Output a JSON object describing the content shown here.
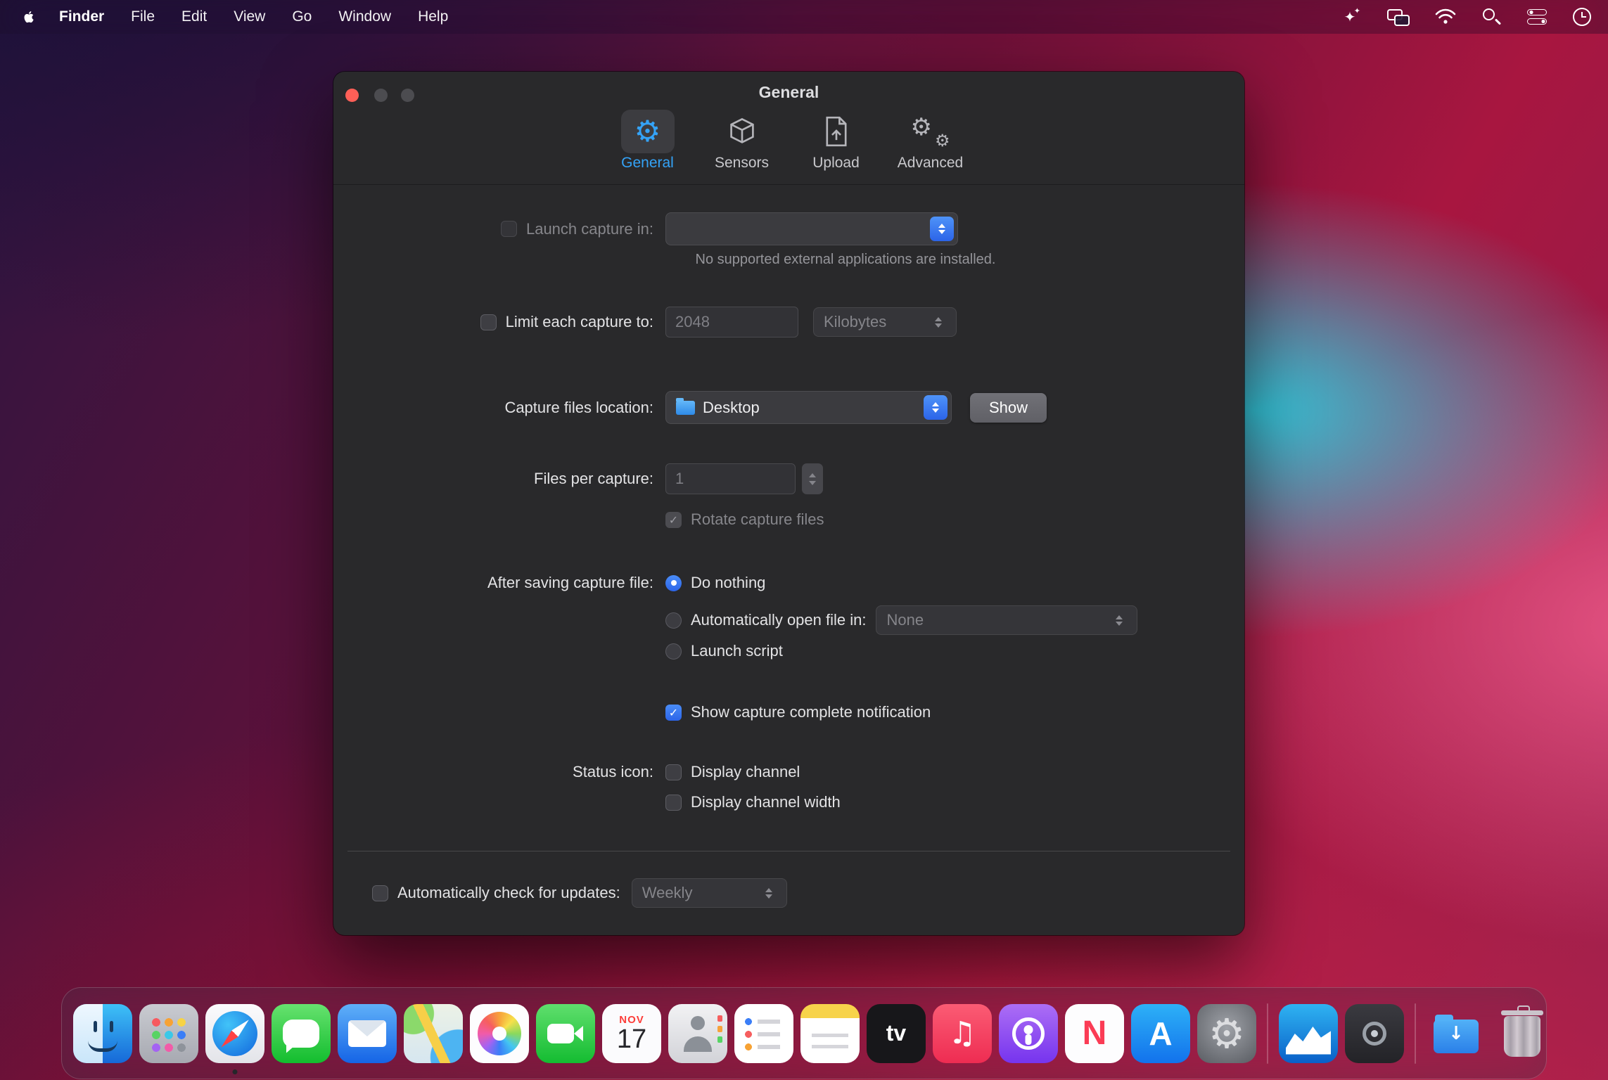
{
  "menu_bar": {
    "app_name": "Finder",
    "menus": [
      "File",
      "Edit",
      "View",
      "Go",
      "Window",
      "Help"
    ],
    "status_icons": [
      "menu-extra",
      "windows",
      "wifi",
      "search",
      "control-center",
      "clock"
    ]
  },
  "window": {
    "title": "General",
    "toolbar": {
      "tabs": [
        {
          "label": "General",
          "active": true
        },
        {
          "label": "Sensors",
          "active": false
        },
        {
          "label": "Upload",
          "active": false
        },
        {
          "label": "Advanced",
          "active": false
        }
      ]
    },
    "form": {
      "launch_capture": {
        "label": "Launch capture in:",
        "helper": "No supported external applications are installed.",
        "checked": false
      },
      "limit_capture": {
        "label": "Limit each capture to:",
        "value": "2048",
        "unit": "Kilobytes",
        "checked": false
      },
      "location": {
        "label": "Capture files location:",
        "value": "Desktop",
        "show_button": "Show"
      },
      "files_per_capture": {
        "label": "Files per capture:",
        "value": "1",
        "rotate": "Rotate capture files",
        "rotate_checked": true
      },
      "after_saving": {
        "label": "After saving capture file:",
        "do_nothing": "Do nothing",
        "open_in": "Automatically open file in:",
        "open_in_value": "None",
        "launch_script": "Launch script",
        "selected": "Do nothing",
        "notification": "Show capture complete notification",
        "notification_checked": true
      },
      "status_icon": {
        "label": "Status icon:",
        "channel": "Display channel",
        "channel_width": "Display channel width"
      },
      "updates": {
        "label": "Automatically check for updates:",
        "value": "Weekly",
        "checked": false
      }
    }
  },
  "dock": {
    "calendar": {
      "month": "NOV",
      "day": "17"
    },
    "tv_label": "tv",
    "news_letter": "N",
    "appstore_letter": "A",
    "apps": [
      "Finder",
      "Launchpad",
      "Safari",
      "Messages",
      "Mail",
      "Maps",
      "Photos",
      "FaceTime",
      "Calendar",
      "Contacts",
      "Reminders",
      "Notes",
      "TV",
      "Music",
      "Podcasts",
      "News",
      "App Store",
      "System Preferences",
      "Capture App",
      "Camera Utility",
      "Downloads",
      "Trash"
    ]
  },
  "colors": {
    "accent_blue": "#3478f6",
    "tab_active_blue": "#34a3f7",
    "close_red": "#ff5f57"
  }
}
